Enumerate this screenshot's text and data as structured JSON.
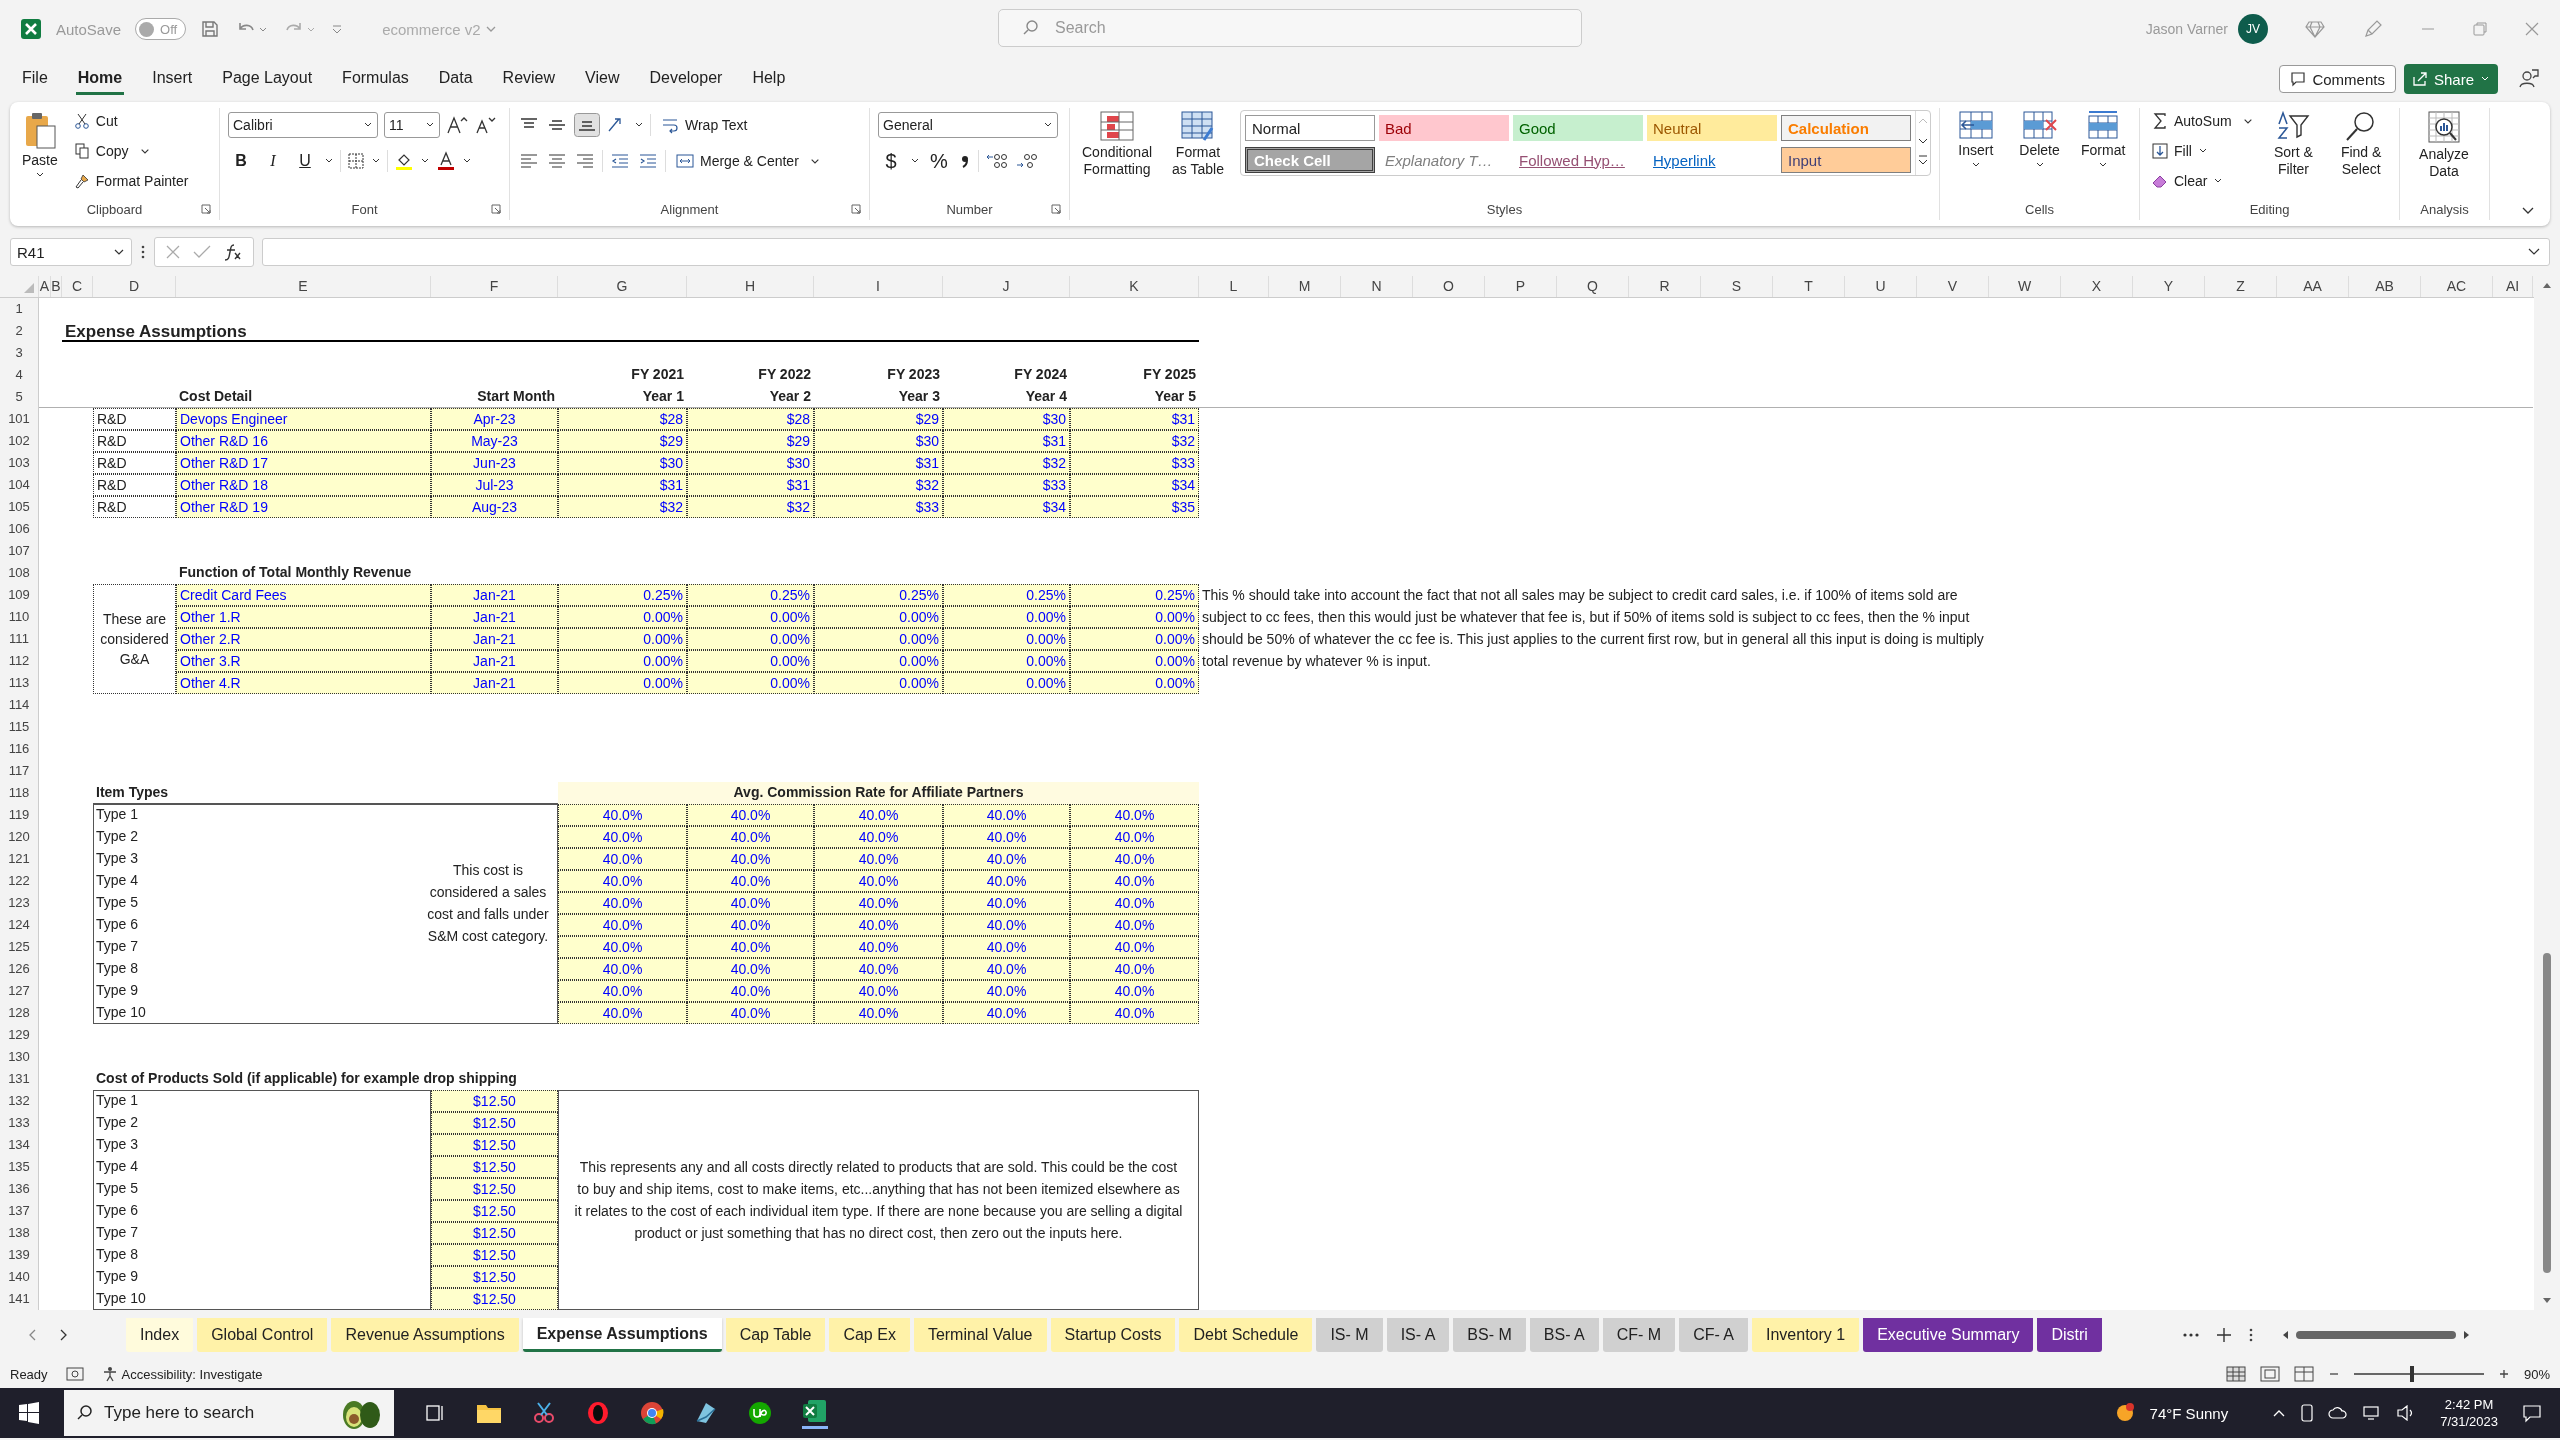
{
  "title_bar": {
    "autosave": {
      "label": "AutoSave",
      "on": false,
      "state_text": "Off"
    },
    "file_name": "ecommerce v2",
    "search": {
      "placeholder": "Search"
    },
    "user_name": "Jason Varner",
    "avatar_initials": "JV"
  },
  "menu_tabs": [
    {
      "label": "File",
      "selected": false
    },
    {
      "label": "Home",
      "selected": true
    },
    {
      "label": "Insert",
      "selected": false
    },
    {
      "label": "Page Layout",
      "selected": false
    },
    {
      "label": "Formulas",
      "selected": false
    },
    {
      "label": "Data",
      "selected": false
    },
    {
      "label": "Review",
      "selected": false
    },
    {
      "label": "View",
      "selected": false
    },
    {
      "label": "Developer",
      "selected": false
    },
    {
      "label": "Help",
      "selected": false
    }
  ],
  "menu_actions": {
    "comments": "Comments",
    "share": "Share"
  },
  "ribbon": {
    "clipboard": {
      "label": "Clipboard",
      "paste": "Paste",
      "cut": "Cut",
      "copy": "Copy",
      "format_painter": "Format Painter"
    },
    "font": {
      "label": "Font",
      "name": "Calibri",
      "size": "11",
      "bold": "B",
      "italic": "I",
      "underline": "U"
    },
    "alignment": {
      "label": "Alignment",
      "wrap_text": "Wrap Text",
      "merge_center": "Merge & Center"
    },
    "number": {
      "label": "Number",
      "format": "General",
      "currency": "$",
      "percent": "%"
    },
    "styles": {
      "label": "Styles",
      "conditional_formatting": "Conditional Formatting",
      "format_as_table": "Format as Table",
      "gallery": [
        {
          "label": "Normal",
          "kind": "normal"
        },
        {
          "label": "Bad",
          "kind": "bad"
        },
        {
          "label": "Good",
          "kind": "good"
        },
        {
          "label": "Neutral",
          "kind": "neutral"
        },
        {
          "label": "Calculation",
          "kind": "calculation"
        },
        {
          "label": "Check Cell",
          "kind": "check"
        },
        {
          "label": "Explanatory T…",
          "kind": "explanatory"
        },
        {
          "label": "Followed Hyp…",
          "kind": "followed"
        },
        {
          "label": "Hyperlink",
          "kind": "hyperlink"
        },
        {
          "label": "Input",
          "kind": "input"
        }
      ]
    },
    "cells": {
      "label": "Cells",
      "insert": "Insert",
      "delete": "Delete",
      "format": "Format"
    },
    "editing": {
      "label": "Editing",
      "autosum": "AutoSum",
      "fill": "Fill",
      "clear": "Clear",
      "sort_filter": "Sort & Filter",
      "find_select": "Find & Select"
    },
    "analysis": {
      "label": "Analysis",
      "analyze_data": "Analyze Data"
    }
  },
  "formula_bar": {
    "name_box": "R41"
  },
  "sheet": {
    "column_headers": [
      "A",
      "B",
      "C",
      "D",
      "E",
      "F",
      "G",
      "H",
      "I",
      "J",
      "K",
      "L",
      "M",
      "N",
      "O",
      "P",
      "Q",
      "R",
      "S",
      "T",
      "U",
      "V",
      "W",
      "X",
      "Y",
      "Z",
      "AA",
      "AB",
      "AC",
      "AI"
    ],
    "row_headers": [
      "1",
      "2",
      "3",
      "4",
      "5",
      "101",
      "102",
      "103",
      "104",
      "105",
      "106",
      "107",
      "108",
      "109",
      "110",
      "111",
      "112",
      "113",
      "114",
      "115",
      "116",
      "117",
      "118",
      "119",
      "120",
      "121",
      "122",
      "123",
      "124",
      "125",
      "126",
      "127",
      "128",
      "129",
      "130",
      "131",
      "132",
      "133",
      "134",
      "135",
      "136",
      "137",
      "138",
      "139",
      "140",
      "141"
    ],
    "title": "Expense Assumptions",
    "header": {
      "cost_detail": "Cost Detail",
      "start_month": "Start Month",
      "fiscal_years": [
        "FY 2021",
        "FY 2022",
        "FY 2023",
        "FY 2024",
        "FY 2025"
      ],
      "years": [
        "Year 1",
        "Year 2",
        "Year 3",
        "Year 4",
        "Year 5"
      ]
    },
    "rd_rows": [
      {
        "category": "R&D",
        "name": "Devops Engineer",
        "start": "Apr-23",
        "values": [
          "$28",
          "$28",
          "$29",
          "$30",
          "$31"
        ]
      },
      {
        "category": "R&D",
        "name": "Other R&D 16",
        "start": "May-23",
        "values": [
          "$29",
          "$29",
          "$30",
          "$31",
          "$32"
        ]
      },
      {
        "category": "R&D",
        "name": "Other R&D 17",
        "start": "Jun-23",
        "values": [
          "$30",
          "$30",
          "$31",
          "$32",
          "$33"
        ]
      },
      {
        "category": "R&D",
        "name": "Other R&D 18",
        "start": "Jul-23",
        "values": [
          "$31",
          "$31",
          "$32",
          "$33",
          "$34"
        ]
      },
      {
        "category": "R&D",
        "name": "Other R&D 19",
        "start": "Aug-23",
        "values": [
          "$32",
          "$32",
          "$33",
          "$34",
          "$35"
        ]
      }
    ],
    "revenue": {
      "title": "Function of Total Monthly Revenue",
      "group_label": "These are considered G&A",
      "rows": [
        {
          "name": "Credit Card Fees",
          "start": "Jan-21",
          "values": [
            "0.25%",
            "0.25%",
            "0.25%",
            "0.25%",
            "0.25%"
          ]
        },
        {
          "name": "Other 1.R",
          "start": "Jan-21",
          "values": [
            "0.00%",
            "0.00%",
            "0.00%",
            "0.00%",
            "0.00%"
          ]
        },
        {
          "name": "Other 2.R",
          "start": "Jan-21",
          "values": [
            "0.00%",
            "0.00%",
            "0.00%",
            "0.00%",
            "0.00%"
          ]
        },
        {
          "name": "Other 3.R",
          "start": "Jan-21",
          "values": [
            "0.00%",
            "0.00%",
            "0.00%",
            "0.00%",
            "0.00%"
          ]
        },
        {
          "name": "Other 4.R",
          "start": "Jan-21",
          "values": [
            "0.00%",
            "0.00%",
            "0.00%",
            "0.00%",
            "0.00%"
          ]
        }
      ],
      "note": "This % should take into account the fact that not all sales may be subject to credit card sales, i.e. if 100% of items sold are subject to cc fees, then this would just be whatever that fee is, but if 50% of items sold is subject to cc fees, then the % input should be 50% of whatever the cc fee is. This just applies to the current first row, but in general all this input is doing is multiply total revenue by whatever % is input."
    },
    "commission": {
      "title": "Item Types",
      "header": "Avg. Commission Rate for Affiliate Partners",
      "note": "This cost is considered a sales cost and falls under S&M cost category.",
      "rows": [
        {
          "type": "Type 1",
          "values": [
            "40.0%",
            "40.0%",
            "40.0%",
            "40.0%",
            "40.0%"
          ]
        },
        {
          "type": "Type 2",
          "values": [
            "40.0%",
            "40.0%",
            "40.0%",
            "40.0%",
            "40.0%"
          ]
        },
        {
          "type": "Type 3",
          "values": [
            "40.0%",
            "40.0%",
            "40.0%",
            "40.0%",
            "40.0%"
          ]
        },
        {
          "type": "Type 4",
          "values": [
            "40.0%",
            "40.0%",
            "40.0%",
            "40.0%",
            "40.0%"
          ]
        },
        {
          "type": "Type 5",
          "values": [
            "40.0%",
            "40.0%",
            "40.0%",
            "40.0%",
            "40.0%"
          ]
        },
        {
          "type": "Type 6",
          "values": [
            "40.0%",
            "40.0%",
            "40.0%",
            "40.0%",
            "40.0%"
          ]
        },
        {
          "type": "Type 7",
          "values": [
            "40.0%",
            "40.0%",
            "40.0%",
            "40.0%",
            "40.0%"
          ]
        },
        {
          "type": "Type 8",
          "values": [
            "40.0%",
            "40.0%",
            "40.0%",
            "40.0%",
            "40.0%"
          ]
        },
        {
          "type": "Type 9",
          "values": [
            "40.0%",
            "40.0%",
            "40.0%",
            "40.0%",
            "40.0%"
          ]
        },
        {
          "type": "Type 10",
          "values": [
            "40.0%",
            "40.0%",
            "40.0%",
            "40.0%",
            "40.0%"
          ]
        }
      ]
    },
    "cogs": {
      "title": "Cost of Products Sold (if applicable) for example drop shipping",
      "note": "This represents any and all costs directly related to products that are sold. This could be the cost to buy and ship items, cost to make items, etc...anything that has not been itemized elsewhere as it relates to the cost of each individual item type. If there are none because you are selling a digital product or just something that has no direct cost, then zero out the inputs here.",
      "rows": [
        {
          "type": "Type 1",
          "value": "$12.50"
        },
        {
          "type": "Type 2",
          "value": "$12.50"
        },
        {
          "type": "Type 3",
          "value": "$12.50"
        },
        {
          "type": "Type 4",
          "value": "$12.50"
        },
        {
          "type": "Type 5",
          "value": "$12.50"
        },
        {
          "type": "Type 6",
          "value": "$12.50"
        },
        {
          "type": "Type 7",
          "value": "$12.50"
        },
        {
          "type": "Type 8",
          "value": "$12.50"
        },
        {
          "type": "Type 9",
          "value": "$12.50"
        },
        {
          "type": "Type 10",
          "value": "$12.50"
        }
      ]
    }
  },
  "sheet_tabs": [
    {
      "label": "Index",
      "color": "#fffbdc",
      "selected": false
    },
    {
      "label": "Global Control",
      "color": "#fff2a8",
      "selected": false
    },
    {
      "label": "Revenue Assumptions",
      "color": "#fff2a8",
      "selected": false
    },
    {
      "label": "Expense Assumptions",
      "selected": true
    },
    {
      "label": "Cap Table",
      "color": "#fff2a8",
      "selected": false
    },
    {
      "label": "Cap Ex",
      "color": "#fff2a8",
      "selected": false
    },
    {
      "label": "Terminal Value",
      "color": "#fff2a8",
      "selected": false
    },
    {
      "label": "Startup Costs",
      "color": "#fff2a8",
      "selected": false
    },
    {
      "label": "Debt Schedule",
      "color": "#fff2a8",
      "selected": false
    },
    {
      "label": "IS- M",
      "color": "#d0d0d0",
      "selected": false
    },
    {
      "label": "IS- A",
      "color": "#d0d0d0",
      "selected": false
    },
    {
      "label": "BS- M",
      "color": "#d0d0d0",
      "selected": false
    },
    {
      "label": "BS- A",
      "color": "#d0d0d0",
      "selected": false
    },
    {
      "label": "CF- M",
      "color": "#d0d0d0",
      "selected": false
    },
    {
      "label": "CF- A",
      "color": "#d0d0d0",
      "selected": false
    },
    {
      "label": "Inventory 1",
      "color": "#fff2a8",
      "selected": false
    },
    {
      "label": "Executive Summary",
      "color": "#7030a0",
      "selected": false
    },
    {
      "label": "Distri",
      "color": "#7030a0",
      "selected": false
    }
  ],
  "status_bar": {
    "status": "Ready",
    "accessibility": "Accessibility: Investigate",
    "zoom": {
      "label": "90%",
      "level": 0.45
    }
  },
  "taskbar": {
    "search": {
      "placeholder": "Type here to search"
    },
    "weather": "74°F Sunny",
    "time": "2:42 PM",
    "date": "7/31/2023"
  }
}
